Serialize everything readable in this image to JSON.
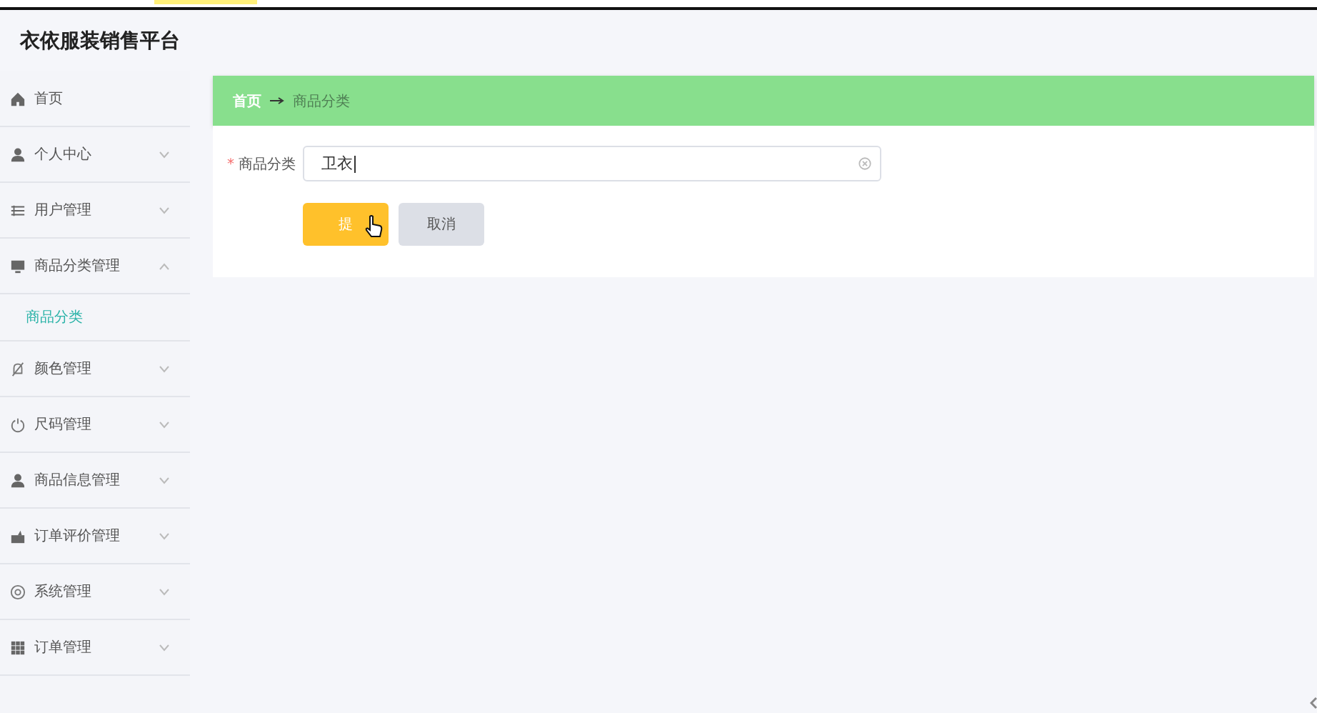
{
  "header": {
    "title": "衣依服装销售平台"
  },
  "sidebar": {
    "items": [
      {
        "label": "首页",
        "expandable": false
      },
      {
        "label": "个人中心",
        "expandable": true,
        "expanded": false
      },
      {
        "label": "用户管理",
        "expandable": true,
        "expanded": false
      },
      {
        "label": "商品分类管理",
        "expandable": true,
        "expanded": true,
        "children": [
          {
            "label": "商品分类",
            "selected": true
          }
        ]
      },
      {
        "label": "颜色管理",
        "expandable": true,
        "expanded": false
      },
      {
        "label": "尺码管理",
        "expandable": true,
        "expanded": false
      },
      {
        "label": "商品信息管理",
        "expandable": true,
        "expanded": false
      },
      {
        "label": "订单评价管理",
        "expandable": true,
        "expanded": false
      },
      {
        "label": "系统管理",
        "expandable": true,
        "expanded": false
      },
      {
        "label": "订单管理",
        "expandable": true,
        "expanded": false
      }
    ]
  },
  "breadcrumb": [
    {
      "label": "首页",
      "selected": false
    },
    {
      "label": "商品分类",
      "selected": true
    }
  ],
  "form": {
    "fields": [
      {
        "label": "商品分类",
        "required_mark": "*",
        "value": "卫衣"
      }
    ],
    "buttons": [
      {
        "label": "提",
        "kind": "primary"
      },
      {
        "label": "取消",
        "kind": "secondary"
      }
    ]
  }
}
